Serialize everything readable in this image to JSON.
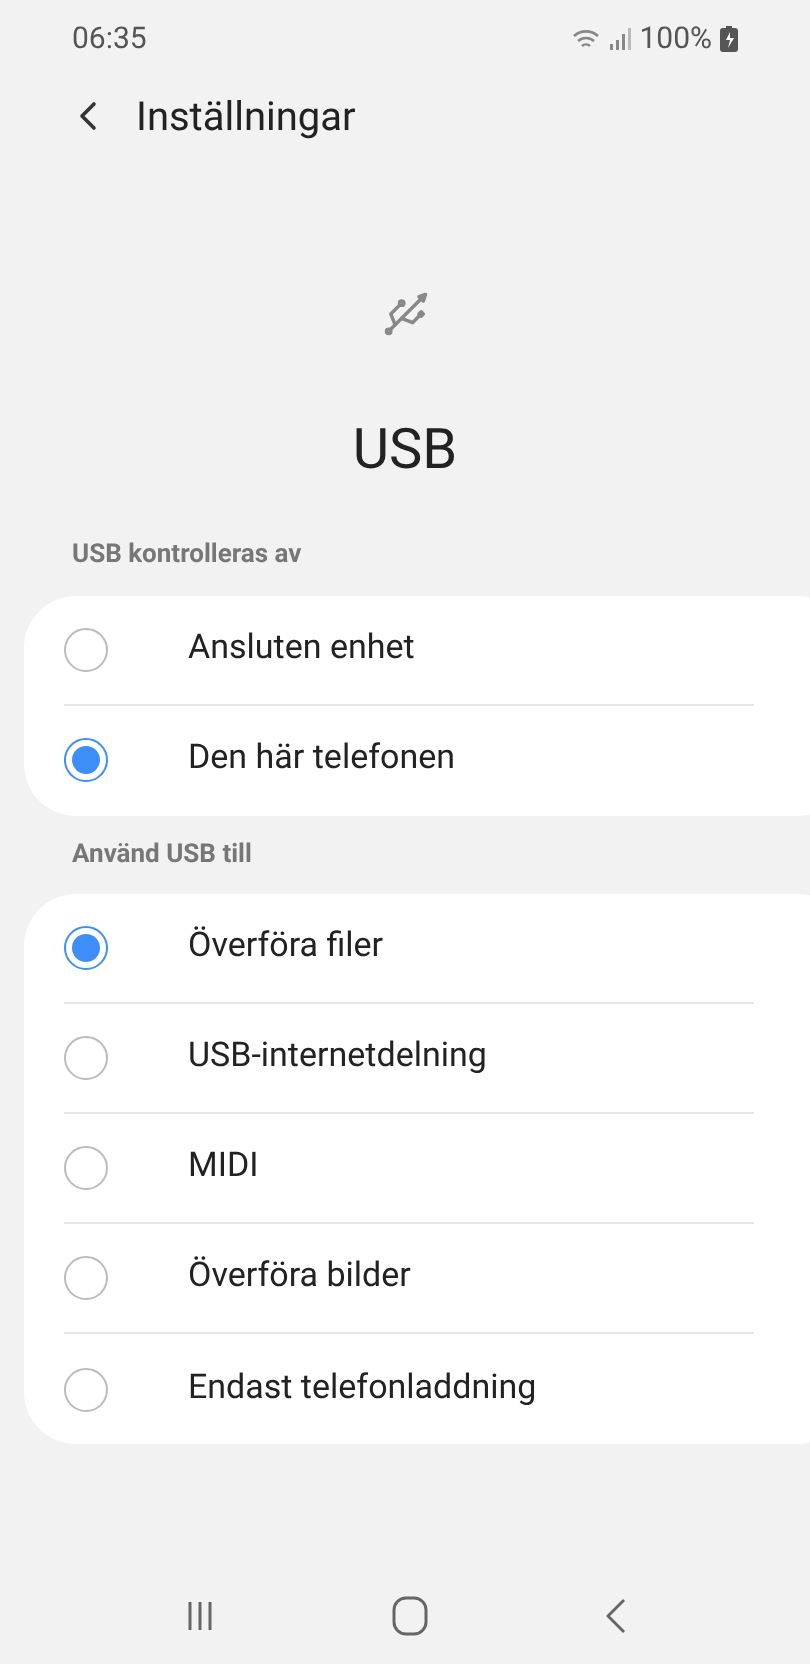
{
  "status_bar": {
    "time": "06:35",
    "battery": "100%"
  },
  "header": {
    "title": "Inställningar"
  },
  "page_title": "USB",
  "groups": [
    {
      "label": "USB kontrolleras av",
      "options": [
        {
          "label": "Ansluten enhet",
          "selected": false
        },
        {
          "label": "Den här telefonen",
          "selected": true
        }
      ]
    },
    {
      "label": "Använd USB till",
      "options": [
        {
          "label": "Överföra filer",
          "selected": true
        },
        {
          "label": "USB-internetdelning",
          "selected": false
        },
        {
          "label": "MIDI",
          "selected": false
        },
        {
          "label": "Överföra bilder",
          "selected": false
        },
        {
          "label": "Endast telefonladdning",
          "selected": false
        }
      ]
    }
  ]
}
